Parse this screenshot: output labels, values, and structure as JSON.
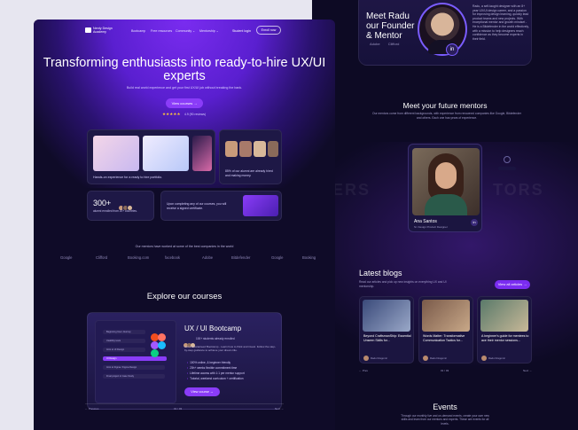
{
  "nav": {
    "logo": "Nerdy Design Academy",
    "items": [
      "Bootcamp",
      "Free resources",
      "Community ⌄",
      "Mentorship ⌄"
    ],
    "login": "Student login",
    "enroll": "Enroll now"
  },
  "hero": {
    "title": "Transforming enthusiasts into ready-to-hire UX/UI experts",
    "subtitle": "Build real world experience and get your first UX/UI job without breaking the bank.",
    "cta": "View courses →",
    "stars": "★★★★★",
    "reviews": "4.9 (90 reviews)"
  },
  "highlights": {
    "portfolio_caption": "Hands-on experience for a ready to hire portfolio.",
    "hired_caption": "85% of our alumni are already hired and making money.",
    "alumni_count": "300+",
    "alumni_caption": "alumni enrolled from 20+ countries.",
    "certificate_caption": "Upon completing any of our courses, you will receive a signed certificate."
  },
  "companies": {
    "caption": "Our mentors have worked at some of the best companies in the world",
    "names": [
      "Google",
      "Clifford",
      "Booking.com",
      "facebook",
      "Adobe",
      "Bitdefender",
      "Google",
      "Booking"
    ]
  },
  "courses": {
    "title": "Explore our courses",
    "course_title": "UX / UI Bootcamp",
    "course_meta": "100+ students already enrolled",
    "course_desc": "Get a Guaranteed Bootcamp - Learn how to think and invest. Follow the step-by-step guidance to achieve your dream title.",
    "bullets": [
      "100% online, & beginner friendly",
      "20h+ weeks flexible commitment time",
      "Lifetime access with 1:1 per mentor support",
      "Tutorial, weekend curriculum + certification"
    ],
    "cta": "View course →",
    "mock_rows": [
      "Beginning User Journey",
      "Usability tests",
      "Intro to UI Design",
      "UI Design",
      "Intro to Figma / Figma Design",
      "Final project in Case Study"
    ],
    "pager_prev": "← Previous",
    "pager_mid": "01 / 03",
    "pager_next": "Next →"
  },
  "founder": {
    "title": "Meet Radu our Founder & Mentor",
    "desc": "Radu, a self-taught designer with an 8+ year UX/UI design career, and a passion for improving design learning, quickly lead product teams and new projects. With exceptional mentor and growth mindset - He is a Bitdefender in the world effectively, with a mission to help designers reach confidence as they become experts in their field.",
    "logos": [
      "Adobe",
      "Clifford"
    ]
  },
  "mentors": {
    "title": "Meet your future mentors",
    "subtitle": "Our mentors come from different backgrounds, with experience from renowned companies like Google, Bitdefender and others. Each one has years of experience.",
    "name": "Ana Santos",
    "role": "Sr. Design Product Designer",
    "ghost": "TORS"
  },
  "blogs": {
    "title": "Latest blogs",
    "subtitle": "Read our articles and pick up new insights on everything UX and UI mentorship.",
    "cta": "View all articles →",
    "items": [
      {
        "title": "Beyond CraftsmanShip: Essential Unseen Skills for...",
        "author": "Radu Dragomir"
      },
      {
        "title": "Words Matter: Transformative Communication Tactics for...",
        "author": "Radu Dragomir"
      },
      {
        "title": "A beginner's guide for mentees to ace their mentor sessions...",
        "author": "Radu Dragomir"
      }
    ],
    "pager_prev": "← Prev",
    "pager_mid": "01 / 03",
    "pager_next": "Next →"
  },
  "events": {
    "title": "Events",
    "subtitle": "Through our monthly live and on-demand events, create your own new skills and learn from our mentors and experts. These are events for all levels."
  },
  "colors": {
    "accent": "#8a3cf8",
    "background": "#0f0b28",
    "star": "#ffc83a"
  }
}
